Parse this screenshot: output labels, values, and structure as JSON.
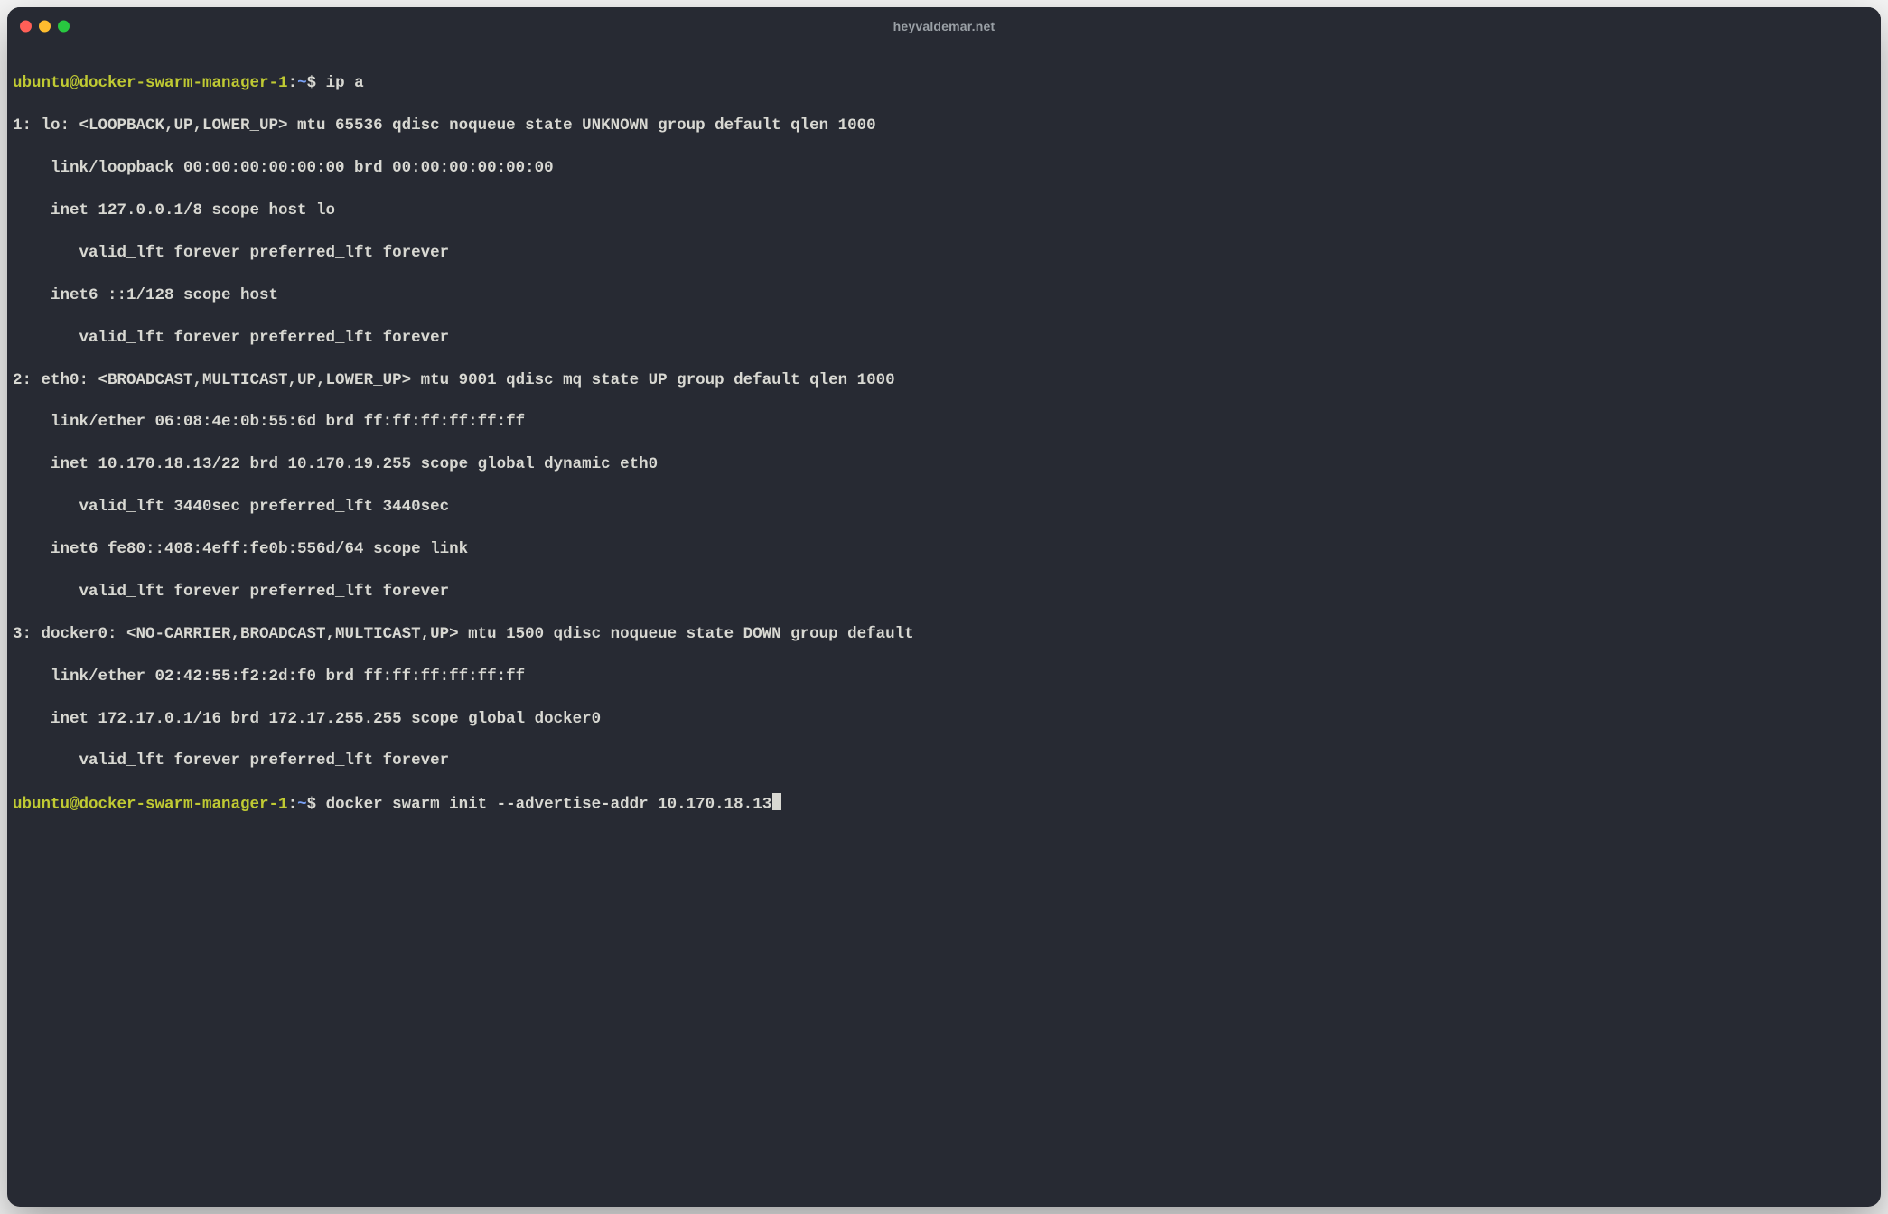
{
  "window": {
    "title": "heyvaldemar.net"
  },
  "prompt": {
    "user_host": "ubuntu@docker-swarm-manager-1",
    "colon": ":",
    "path": "~",
    "dollar": "$"
  },
  "commands": {
    "cmd1": " ip a",
    "cmd2": " docker swarm init --advertise-addr 10.170.18.13"
  },
  "output": {
    "l01": "1: lo: <LOOPBACK,UP,LOWER_UP> mtu 65536 qdisc noqueue state UNKNOWN group default qlen 1000",
    "l02": "    link/loopback 00:00:00:00:00:00 brd 00:00:00:00:00:00",
    "l03": "    inet 127.0.0.1/8 scope host lo",
    "l04": "       valid_lft forever preferred_lft forever",
    "l05": "    inet6 ::1/128 scope host",
    "l06": "       valid_lft forever preferred_lft forever",
    "l07": "2: eth0: <BROADCAST,MULTICAST,UP,LOWER_UP> mtu 9001 qdisc mq state UP group default qlen 1000",
    "l08": "    link/ether 06:08:4e:0b:55:6d brd ff:ff:ff:ff:ff:ff",
    "l09": "    inet 10.170.18.13/22 brd 10.170.19.255 scope global dynamic eth0",
    "l10": "       valid_lft 3440sec preferred_lft 3440sec",
    "l11": "    inet6 fe80::408:4eff:fe0b:556d/64 scope link",
    "l12": "       valid_lft forever preferred_lft forever",
    "l13": "3: docker0: <NO-CARRIER,BROADCAST,MULTICAST,UP> mtu 1500 qdisc noqueue state DOWN group default",
    "l14": "    link/ether 02:42:55:f2:2d:f0 brd ff:ff:ff:ff:ff:ff",
    "l15": "    inet 172.17.0.1/16 brd 172.17.255.255 scope global docker0",
    "l16": "       valid_lft forever preferred_lft forever"
  }
}
